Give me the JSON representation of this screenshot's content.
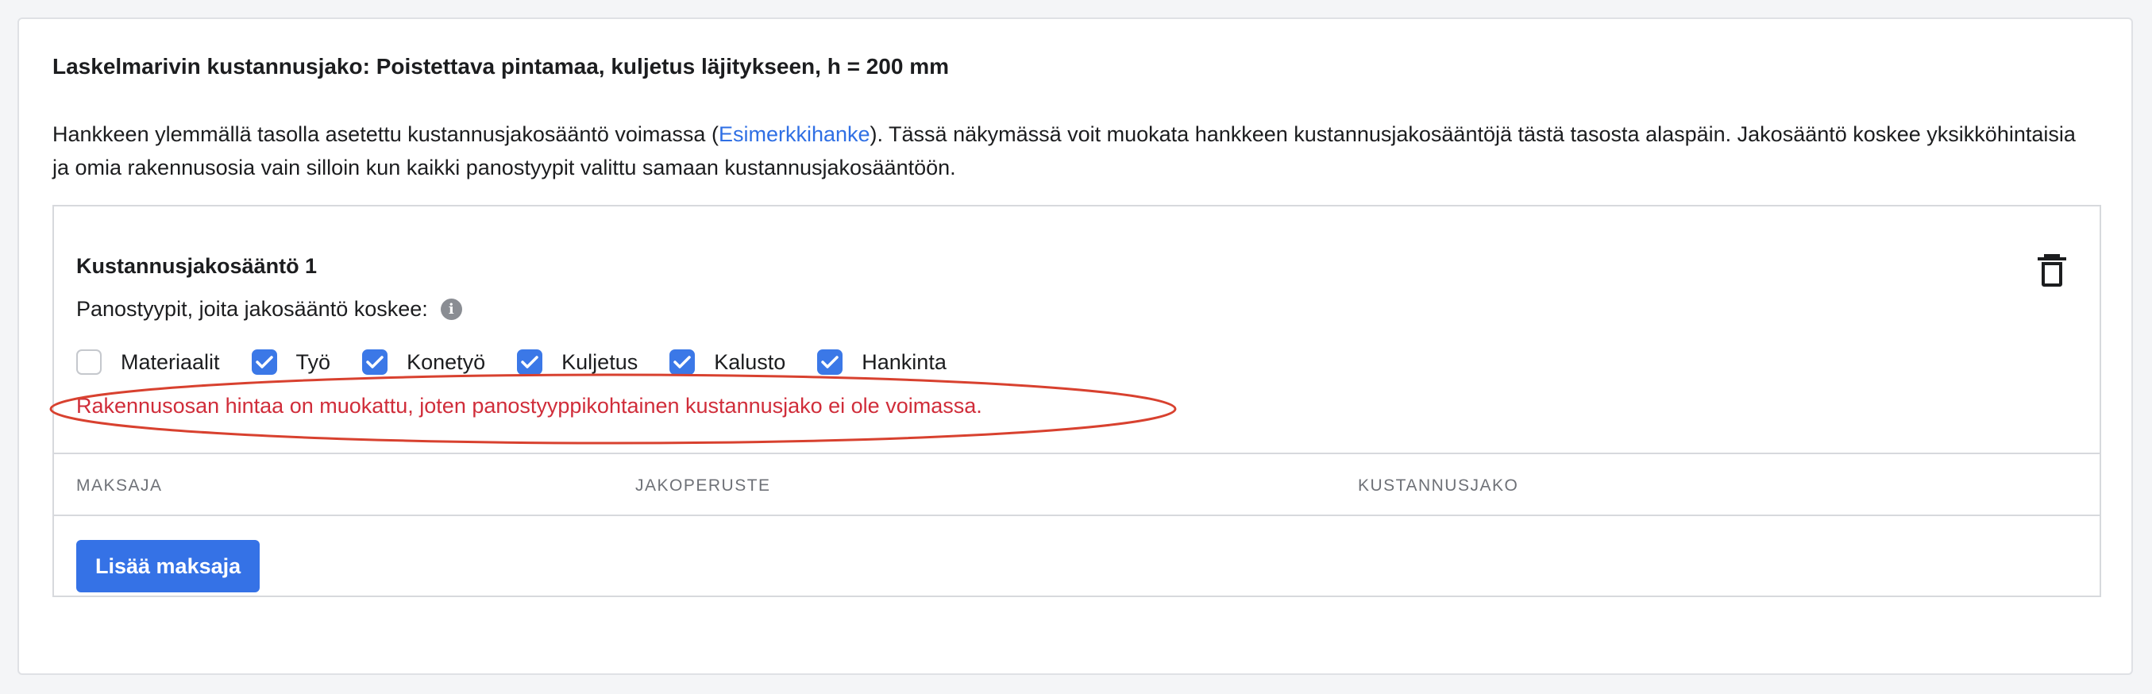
{
  "section": {
    "title": "Laskelmarivin kustannusjako: Poistettava pintamaa, kuljetus läjitykseen, h = 200 mm",
    "description_before": "Hankkeen ylemmällä tasolla asetettu kustannusjakosääntö voimassa (",
    "description_link": "Esimerkkihanke",
    "description_after": "). Tässä näkymässä voit muokata hankkeen kustannusjakosääntöjä tästä tasosta alaspäin. Jakosääntö koskee yksikköhintaisia ja omia rakennusosia vain silloin kun kaikki panostyypit valittu samaan kustannusjakosääntöön."
  },
  "rule": {
    "title": "Kustannusjakosääntö 1",
    "types_label": "Panostyypit, joita jakosääntö koskee:",
    "checkboxes": [
      {
        "label": "Materiaalit",
        "checked": false
      },
      {
        "label": "Työ",
        "checked": true
      },
      {
        "label": "Konetyö",
        "checked": true
      },
      {
        "label": "Kuljetus",
        "checked": true
      },
      {
        "label": "Kalusto",
        "checked": true
      },
      {
        "label": "Hankinta",
        "checked": true
      }
    ],
    "error": "Rakennusosan hintaa on muokattu, joten panostyyppikohtainen kustannusjako ei ole voimassa.",
    "columns": {
      "payer": "MAKSAJA",
      "basis": "JAKOPERUSTE",
      "split": "KUSTANNUSJAKO"
    },
    "add_button": "Lisää maksaja"
  },
  "icons": {
    "delete": "trash-icon",
    "info": "info-icon",
    "check": "checkmark-icon"
  },
  "colors": {
    "accent": "#3572e6",
    "link": "#2f6fe4",
    "error": "#d02d3a",
    "annotation": "#d8412f"
  }
}
